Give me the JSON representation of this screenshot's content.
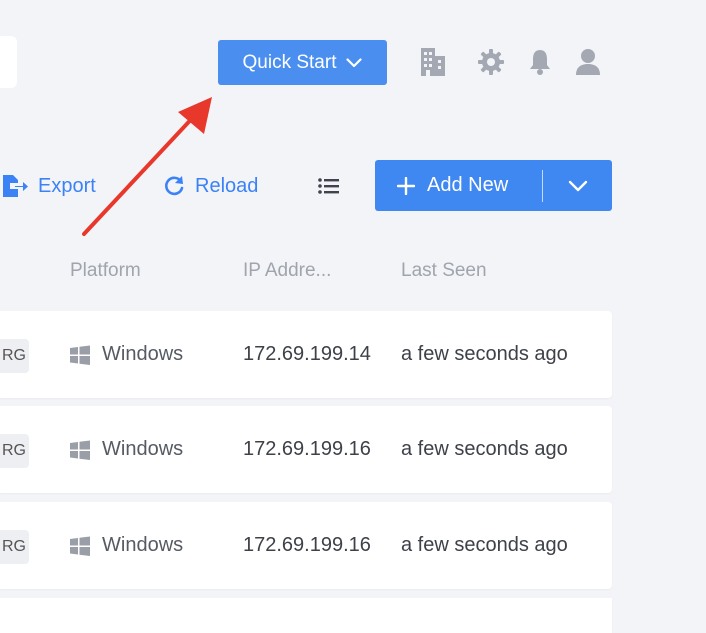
{
  "header": {
    "quick_start_label": "Quick Start",
    "icons": [
      "building-icon",
      "gear-icon",
      "bell-icon",
      "user-icon"
    ]
  },
  "toolbar": {
    "export_label": "Export",
    "reload_label": "Reload",
    "add_new_label": "Add New"
  },
  "table": {
    "columns": [
      "Platform",
      "IP Addre...",
      "Last Seen"
    ],
    "rows": [
      {
        "tag": "RG",
        "platform": "Windows",
        "ip": "172.69.199.14",
        "last_seen": "a few seconds ago"
      },
      {
        "tag": "RG",
        "platform": "Windows",
        "ip": "172.69.199.16",
        "last_seen": "a few seconds ago"
      },
      {
        "tag": "RG",
        "platform": "Windows",
        "ip": "172.69.199.16",
        "last_seen": "a few seconds ago"
      }
    ]
  },
  "colors": {
    "accent": "#4a8ef0",
    "annotation_arrow": "#e8382b",
    "background": "#f3f4f8"
  }
}
